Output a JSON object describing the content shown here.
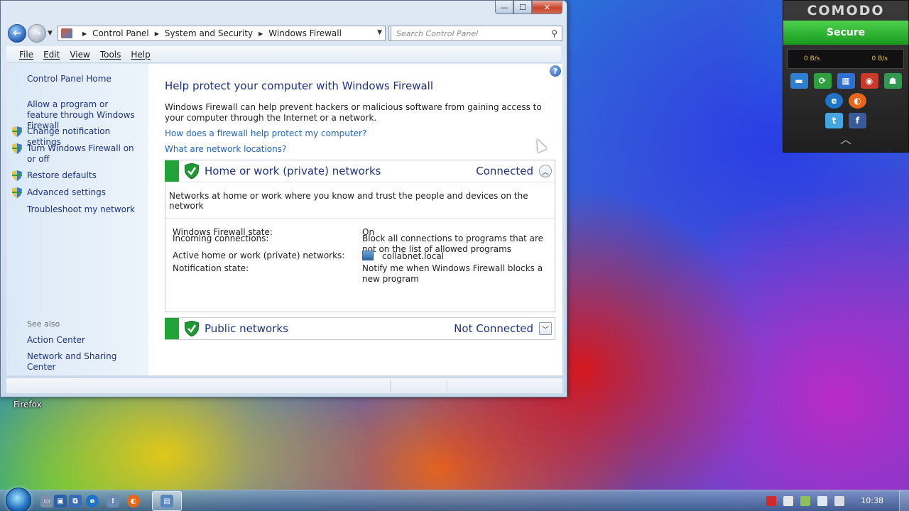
{
  "window": {
    "caption_buttons": {
      "minimize": "—",
      "maximize": "☐",
      "close": "✕"
    }
  },
  "address_bar": {
    "crumbs": [
      "Control Panel",
      "System and Security",
      "Windows Firewall"
    ],
    "search_placeholder": "Search Control Panel"
  },
  "menu": [
    "File",
    "Edit",
    "View",
    "Tools",
    "Help"
  ],
  "left_pane": {
    "home": "Control Panel Home",
    "links": [
      "Allow a program or feature through Windows Firewall",
      "Change notification settings",
      "Turn Windows Firewall on or off",
      "Restore defaults",
      "Advanced settings",
      "Troubleshoot my network"
    ],
    "see_also_label": "See also",
    "see_also": [
      "Action Center",
      "Network and Sharing Center"
    ]
  },
  "main": {
    "title": "Help protect your computer with Windows Firewall",
    "intro": "Windows Firewall can help prevent hackers or malicious software from gaining access to your computer through the Internet or a network.",
    "link_how": "How does a firewall help protect my computer?",
    "link_locations": "What are network locations?",
    "home_network": {
      "title": "Home or work (private) networks",
      "status": "Connected",
      "description": "Networks at home or work where you know and trust the people and devices on the network",
      "rows": [
        {
          "key": "Windows Firewall state:",
          "value": "On"
        },
        {
          "key": "Incoming connections:",
          "value": "Block all connections to programs that are not on the list of allowed programs"
        },
        {
          "key": "Active home or work (private) networks:",
          "value": "collabnet.local"
        },
        {
          "key": "Notification state:",
          "value": "Notify me when Windows Firewall blocks a new program"
        }
      ]
    },
    "public_network": {
      "title": "Public networks",
      "status": "Not Connected"
    }
  },
  "desktop": {
    "icon_label": "Firefox"
  },
  "comodo": {
    "logo": "COMODO",
    "status": "Secure",
    "traffic_in": "0 B/s",
    "traffic_out": "0 B/s",
    "colors": {
      "secure": "#22a82a"
    }
  },
  "taskbar": {
    "clock": "10:38"
  }
}
